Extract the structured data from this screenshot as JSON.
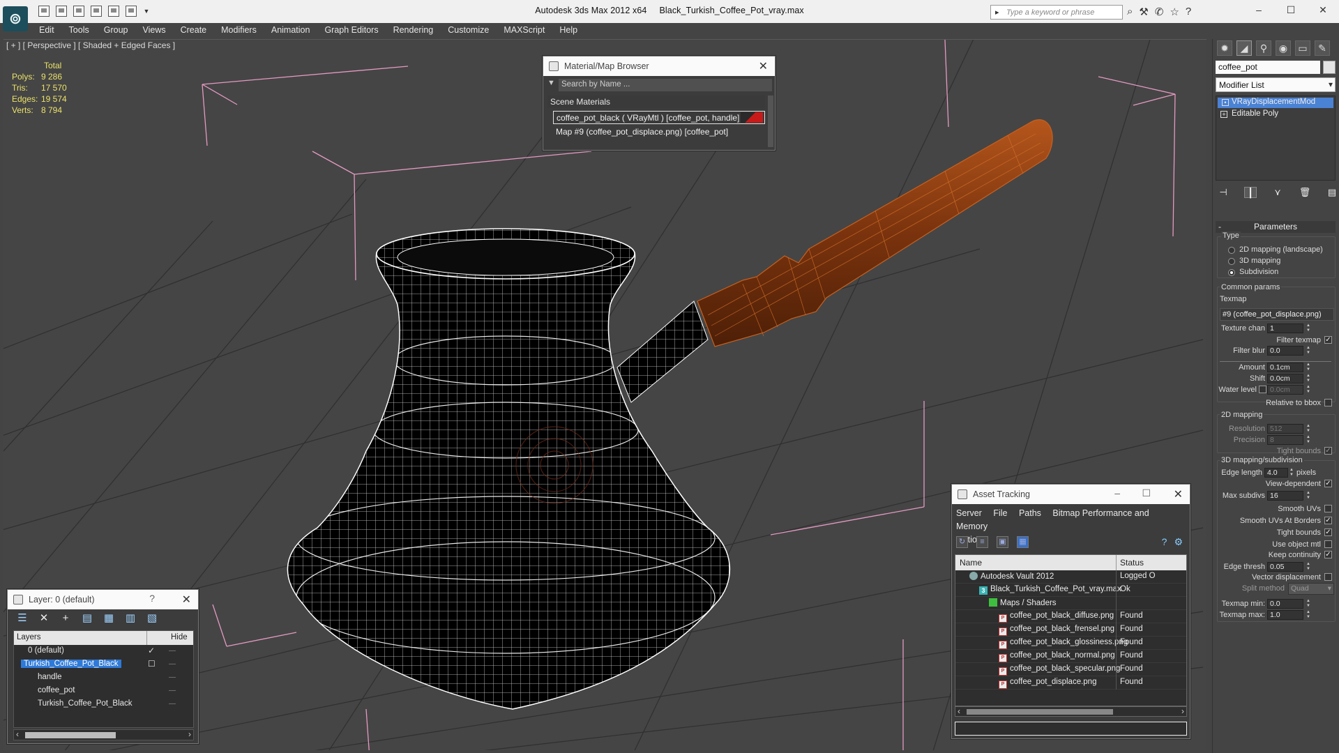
{
  "app": {
    "title": "Autodesk 3ds Max  2012 x64",
    "file": "Black_Turkish_Coffee_Pot_vray.max",
    "search_placeholder": "Type a keyword or phrase",
    "logo": "3ds-max-logo-icon"
  },
  "menu": [
    "Edit",
    "Tools",
    "Group",
    "Views",
    "Create",
    "Modifiers",
    "Animation",
    "Graph Editors",
    "Rendering",
    "Customize",
    "MAXScript",
    "Help"
  ],
  "viewport": {
    "label": "[ + ] [ Perspective ] [ Shaded + Edged Faces ]",
    "stats_header": "Total",
    "stats": [
      {
        "key": "Polys:",
        "value": "9 286"
      },
      {
        "key": "Tris:",
        "value": "17 570"
      },
      {
        "key": "Edges:",
        "value": "19 574"
      },
      {
        "key": "Verts:",
        "value": "8 794"
      }
    ],
    "colors": {
      "background": "#454545",
      "wire": "#ffffff",
      "handle": "#8a3b0f",
      "bbox": "#e59ac2"
    }
  },
  "material_browser": {
    "title": "Material/Map Browser",
    "search_placeholder": "Search by Name ...",
    "section": "Scene Materials",
    "rows": [
      "coffee_pot_black  ( VRayMtl ) [coffee_pot, handle]",
      "Map #9 (coffee_pot_displace.png) [coffee_pot]"
    ]
  },
  "layer_manager": {
    "title": "Layer: 0 (default)",
    "help": "?",
    "col_layers": "Layers",
    "col_hide": "Hide",
    "rows": [
      {
        "name": "0 (default)",
        "indent": 0
      },
      {
        "name": "Turkish_Coffee_Pot_Black",
        "indent": 0
      },
      {
        "name": "handle",
        "indent": 1
      },
      {
        "name": "coffee_pot",
        "indent": 1
      },
      {
        "name": "Turkish_Coffee_Pot_Black",
        "indent": 1
      }
    ]
  },
  "asset_tracking": {
    "title": "Asset Tracking",
    "menu": [
      "Server",
      "File",
      "Paths",
      "Bitmap Performance and Memory",
      "Options"
    ],
    "col_name": "Name",
    "col_status": "Status",
    "rows": [
      {
        "name": "Autodesk Vault 2012",
        "status": "Logged O",
        "icon": "vault"
      },
      {
        "name": "Black_Turkish_Coffee_Pot_vray.max",
        "status": "Ok",
        "icon": "max"
      },
      {
        "name": "Maps / Shaders",
        "status": "",
        "icon": "maps"
      },
      {
        "name": "coffee_pot_black_diffuse.png",
        "status": "Found",
        "icon": "png"
      },
      {
        "name": "coffee_pot_black_frensel.png",
        "status": "Found",
        "icon": "png"
      },
      {
        "name": "coffee_pot_black_glossiness.png",
        "status": "Found",
        "icon": "png"
      },
      {
        "name": "coffee_pot_black_normal.png",
        "status": "Found",
        "icon": "png"
      },
      {
        "name": "coffee_pot_black_specular.png",
        "status": "Found",
        "icon": "png"
      },
      {
        "name": "coffee_pot_displace.png",
        "status": "Found",
        "icon": "png"
      }
    ]
  },
  "command_panel": {
    "object_name": "coffee_pot",
    "modifier_list": "Modifier List",
    "stack": [
      "VRayDisplacementMod",
      "Editable Poly"
    ],
    "parameters": {
      "header": "Parameters",
      "type_label": "Type",
      "type_options": [
        "2D mapping (landscape)",
        "3D mapping",
        "Subdivision"
      ],
      "selected_type": "Subdivision",
      "common_params": "Common params",
      "texmap_label": "Texmap",
      "texmap": "#9 (coffee_pot_displace.png)",
      "texture_chan_label": "Texture chan",
      "texture_chan": "1",
      "filter_texmap": "Filter texmap",
      "filter_blur_label": "Filter blur",
      "filter_blur": "0.0",
      "amount_label": "Amount",
      "amount": "0.1cm",
      "shift_label": "Shift",
      "shift": "0.0cm",
      "water_level_label": "Water level",
      "water_level": "0.0cm",
      "relative_bbox": "Relative to bbox",
      "mapping_2d": "2D mapping",
      "resolution_label": "Resolution",
      "resolution": "512",
      "precision_label": "Precision",
      "precision": "8",
      "tight_bounds": "Tight bounds",
      "mapping_3d": "3D mapping/subdivision",
      "edge_length_label": "Edge length",
      "edge_length": "4.0",
      "pixels": "pixels",
      "view_dependent": "View-dependent",
      "max_subdivs_label": "Max subdivs",
      "max_subdivs": "16",
      "smooth_uvs": "Smooth UVs",
      "smooth_uvs_borders": "Smooth UVs At Borders",
      "tight_bounds_2": "Tight bounds",
      "use_object_mtl": "Use object mtl",
      "keep_continuity": "Keep continuity",
      "edge_thresh_label": "Edge thresh",
      "edge_thresh": "0.05",
      "vector_displacement": "Vector displacement",
      "split_method_label": "Split method",
      "split_method": "Quad",
      "texmap_min_label": "Texmap min:",
      "texmap_min": "0.0",
      "texmap_max_label": "Texmap max:",
      "texmap_max": "1.0"
    }
  }
}
